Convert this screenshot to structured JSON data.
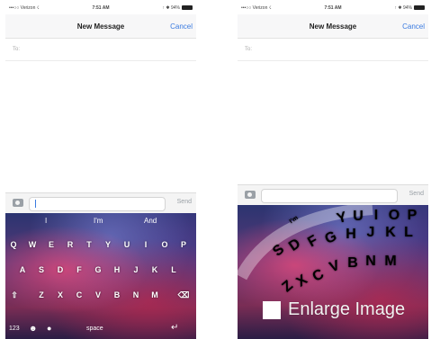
{
  "status": {
    "carrier": "•••○○ Verizon ☇",
    "time": "7:51 AM",
    "battery": "↑ ✱ 94%"
  },
  "nav": {
    "title": "New Message",
    "cancel": "Cancel"
  },
  "compose": {
    "to_label": "To:",
    "send": "Send"
  },
  "left_keyboard": {
    "suggestions": [
      "I",
      "I'm",
      "And"
    ],
    "row1": [
      "Q",
      "W",
      "E",
      "R",
      "T",
      "Y",
      "U",
      "I",
      "O",
      "P"
    ],
    "row2": [
      "A",
      "S",
      "D",
      "F",
      "G",
      "H",
      "J",
      "K",
      "L"
    ],
    "row3": [
      "Z",
      "X",
      "C",
      "V",
      "B",
      "N",
      "M"
    ],
    "shift": "⇧",
    "delete": "⌫",
    "numbers": "123",
    "space": "space",
    "return": "↵"
  },
  "right_keyboard": {
    "arc_word": "I'm",
    "row1": [
      "Y",
      "U",
      "I",
      "O",
      "P"
    ],
    "row2": [
      "G",
      "H",
      "J",
      "K",
      "L"
    ],
    "row3": [
      "V",
      "B",
      "N",
      "M"
    ],
    "row4": [
      "Z",
      "X",
      "C"
    ],
    "row2b": [
      "S",
      "D",
      "F"
    ]
  },
  "enlarge": {
    "label": "Enlarge Image"
  },
  "colors": {
    "accent": "#3b7be0",
    "keyboard_bg": "#5a3a78"
  }
}
